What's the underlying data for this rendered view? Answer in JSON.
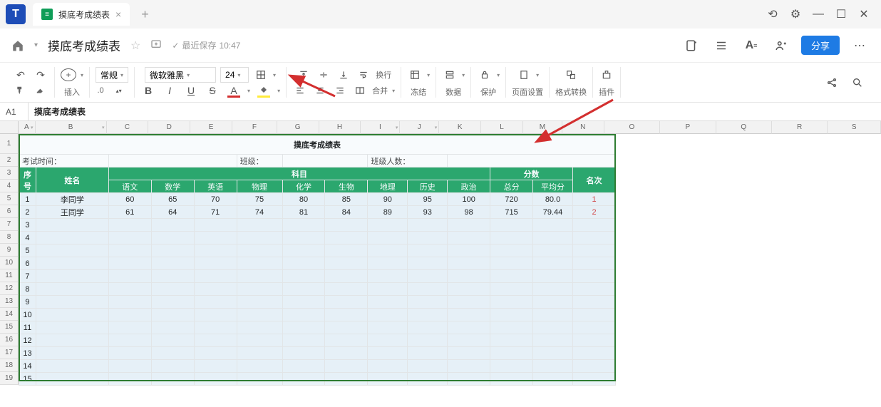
{
  "app": {
    "logo_letter": "T"
  },
  "tab": {
    "title": "摸底考成绩表",
    "icon": "≡"
  },
  "doc": {
    "title": "摸底考成绩表",
    "save_status_prefix": "最近保存",
    "save_time": "10:47",
    "share_label": "分享"
  },
  "toolbar": {
    "insert_label": "插入",
    "format_dd": "常规",
    "font_name": "微软雅黑",
    "font_size": "24",
    "decimal_sample": ".0",
    "wrap_label": "换行",
    "merge_label": "合并",
    "freeze_label": "冻结",
    "data_label": "数据",
    "protect_label": "保护",
    "page_setup_label": "页面设置",
    "format_convert_label": "格式转换",
    "plugin_label": "插件"
  },
  "cellref": {
    "ref": "A1",
    "val": "摸底考成绩表"
  },
  "columns": [
    "A",
    "B",
    "C",
    "D",
    "E",
    "F",
    "G",
    "H",
    "I",
    "J",
    "K",
    "L",
    "M",
    "N",
    "O",
    "P",
    "Q",
    "R",
    "S"
  ],
  "row_numbers": [
    1,
    2,
    3,
    4,
    5,
    6,
    7,
    8,
    9,
    10,
    11,
    12,
    13,
    14,
    15,
    16,
    17,
    18,
    19
  ],
  "sheet": {
    "title": "摸底考成绩表",
    "meta": {
      "exam_time_label": "考试时间：",
      "class_label": "班级：",
      "class_size_label": "班级人数："
    },
    "group_headers": {
      "index": "序号",
      "name": "姓名",
      "subjects": "科目",
      "scores": "分数",
      "rank": "名次"
    },
    "subject_headers": [
      "语文",
      "数学",
      "英语",
      "物理",
      "化学",
      "生物",
      "地理",
      "历史",
      "政治"
    ],
    "score_headers": [
      "总分",
      "平均分"
    ],
    "rows": [
      {
        "idx": "1",
        "name": "李同学",
        "vals": [
          "60",
          "65",
          "70",
          "75",
          "80",
          "85",
          "90",
          "95",
          "100"
        ],
        "total": "720",
        "avg": "80.0",
        "rank": "1"
      },
      {
        "idx": "2",
        "name": "王同学",
        "vals": [
          "61",
          "64",
          "71",
          "74",
          "81",
          "84",
          "89",
          "93",
          "98"
        ],
        "total": "715",
        "avg": "79.44",
        "rank": "2"
      }
    ],
    "empty_indices": [
      "3",
      "4",
      "5",
      "6",
      "7",
      "8",
      "9",
      "10",
      "11",
      "12",
      "13",
      "14",
      "15"
    ]
  }
}
